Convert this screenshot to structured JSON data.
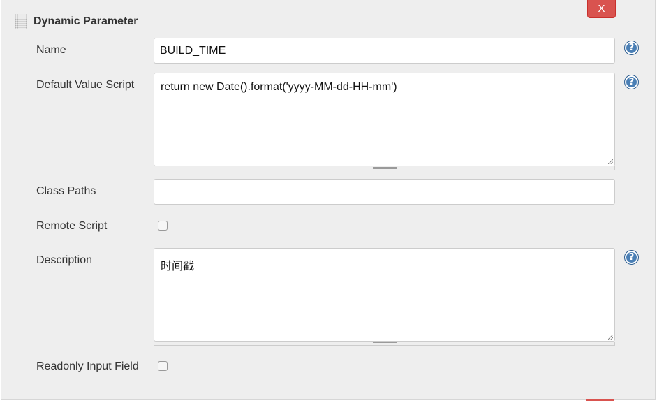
{
  "section": {
    "title": "Dynamic Parameter",
    "delete_label": "X"
  },
  "fields": {
    "name": {
      "label": "Name",
      "value": "BUILD_TIME"
    },
    "default_value_script": {
      "label": "Default Value Script",
      "value": "return new Date().format('yyyy-MM-dd-HH-mm')"
    },
    "class_paths": {
      "label": "Class Paths",
      "value": ""
    },
    "remote_script": {
      "label": "Remote Script",
      "checked": false
    },
    "description": {
      "label": "Description",
      "value": "时间戳"
    },
    "readonly_input_field": {
      "label": "Readonly Input Field",
      "checked": false
    }
  },
  "help": {
    "glyph": "?"
  },
  "colors": {
    "panel_background": "#eeeeee",
    "delete_button": "#d9534f",
    "help_icon": "#4a7fb5"
  }
}
